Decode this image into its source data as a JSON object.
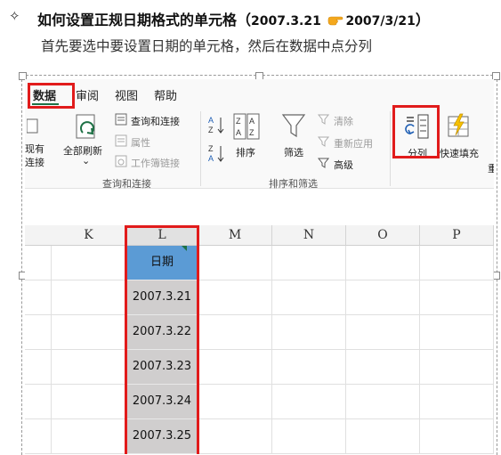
{
  "instruction": {
    "bullet": "✧",
    "heading_main": "如何设置正规日期格式的单元格",
    "heading_open": "（",
    "heading_from": "2007.3.21",
    "heading_to": "2007/3/21",
    "heading_close": "）",
    "subline": "首先要选中要设置日期的单元格，然后在数据中点分列"
  },
  "ribbon": {
    "tabs": [
      "数据",
      "审阅",
      "视图",
      "帮助"
    ],
    "active_tab": "数据",
    "partial_left": [
      "现有",
      "连接"
    ],
    "refresh_all": "全部刷新",
    "query_connect": "查询和连接",
    "properties": "属性",
    "workbook_links": "工作簿链接",
    "group_query": "查询和连接",
    "sort": "排序",
    "filter": "筛选",
    "clear": "清除",
    "reapply": "重新应用",
    "advanced": "高级",
    "group_sort_filter": "排序和筛选",
    "text_to_columns": "分列",
    "flash_fill": "快速填充",
    "partial_right": "重"
  },
  "sheet": {
    "columns": [
      "K",
      "L",
      "M",
      "N",
      "O",
      "P"
    ],
    "selected_column": "L",
    "header_cell": "日期",
    "values": [
      "2007.3.21",
      "2007.3.22",
      "2007.3.23",
      "2007.3.24",
      "2007.3.25"
    ]
  },
  "colors": {
    "highlight": "#e11b1b",
    "header_fill": "#5b9bd5",
    "selected_cells": "#d0cece",
    "excel_green": "#1e7145",
    "pointer_hand": "#f4a81d"
  },
  "icons": [
    "pointing-hand-icon",
    "refresh-icon",
    "query-icon",
    "properties-icon",
    "links-icon",
    "sort-asc-icon",
    "sort-desc-icon",
    "sort-icon",
    "filter-icon",
    "clear-icon",
    "reapply-icon",
    "advanced-icon",
    "text-to-columns-icon",
    "flash-fill-icon"
  ]
}
